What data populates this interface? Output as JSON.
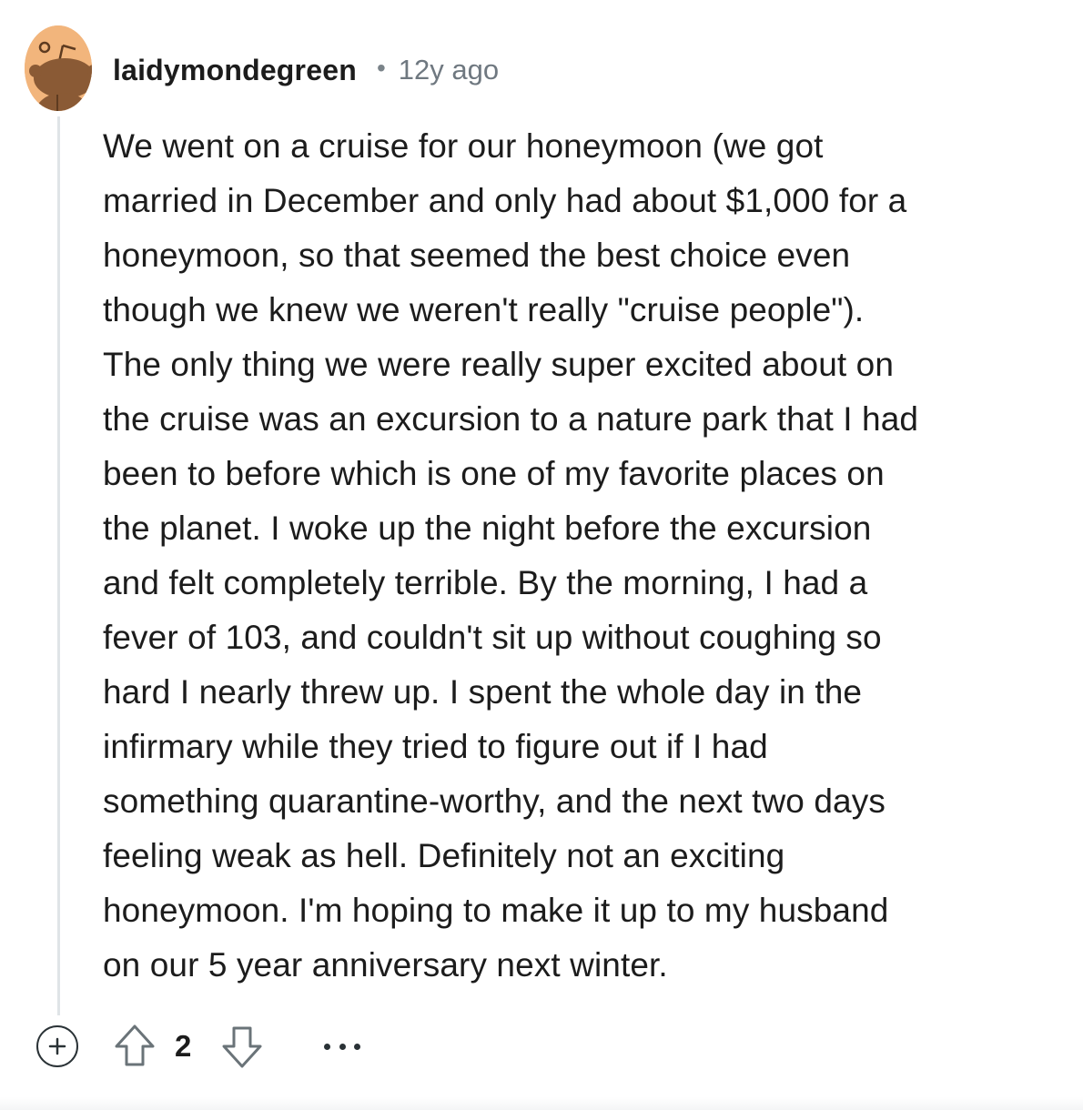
{
  "comment": {
    "username": "laidymondegreen",
    "separator": "•",
    "timestamp": "12y ago",
    "body_lines": [
      "We went on a cruise for our honeymoon (we got",
      "married in December and only had about $1,000 for a",
      "honeymoon, so that seemed the best choice even",
      "though we knew we weren't really \"cruise people\").",
      "The only thing we were really super excited about on",
      "the cruise was an excursion to a nature park that I had",
      "been to before which is one of my favorite places on",
      "the planet. I woke up the night before the excursion",
      "and felt completely terrible. By the morning, I had a",
      "fever of 103, and couldn't sit up without coughing so",
      "hard I nearly threw up. I spent the whole day in the",
      "infirmary while they tried to figure out if I had",
      "something quarantine-worthy, and the next two days",
      "feeling weak as hell. Definitely not an exciting",
      "honeymoon. I'm hoping to make it up to my husband",
      "on our 5 year anniversary next winter."
    ],
    "score": "2"
  },
  "icons": {
    "avatar": "reddit-snoo-avatar",
    "expand": "plus-circle-icon",
    "upvote": "arrow-up-outline-icon",
    "downvote": "arrow-down-outline-icon",
    "more": "ellipsis-icon"
  },
  "colors": {
    "avatar_bg": "#f2b57c",
    "avatar_figure": "#8a5a35",
    "thread_line": "#dfe4e7",
    "text": "#1c1c1c",
    "meta": "#6f7880"
  }
}
